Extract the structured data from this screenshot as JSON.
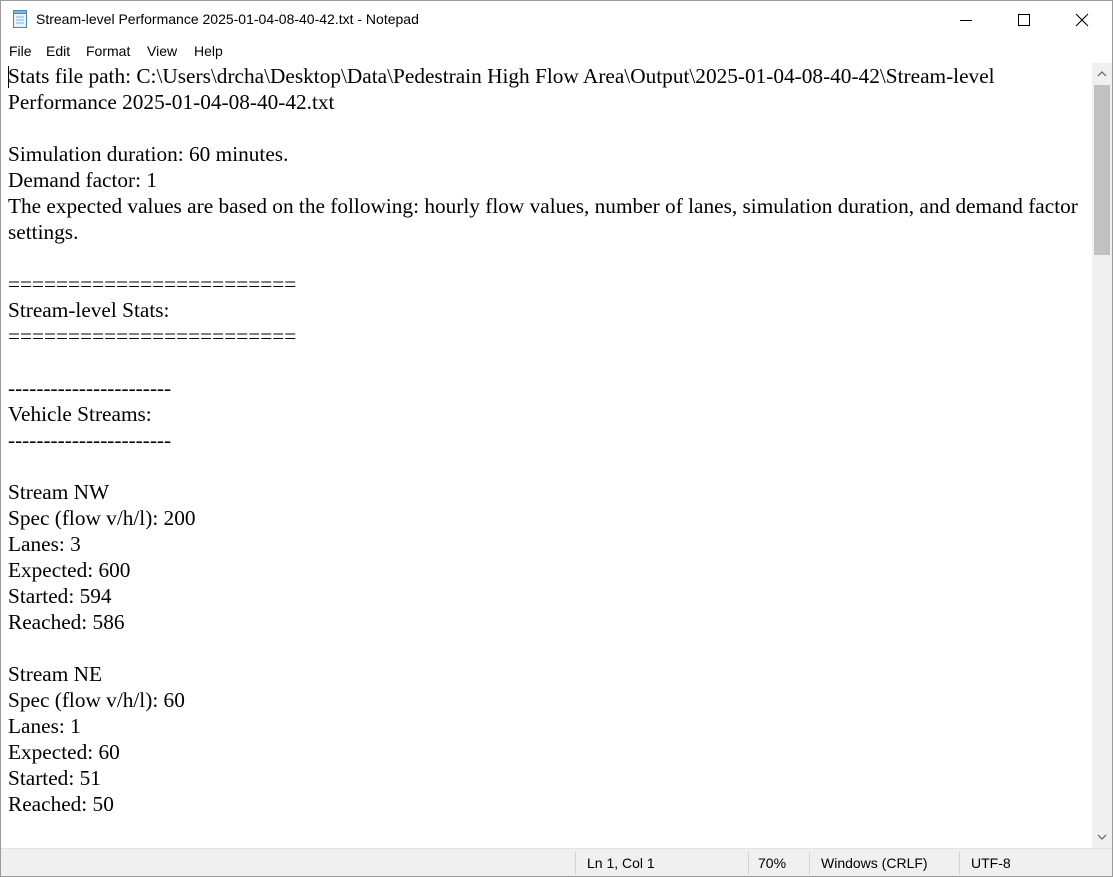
{
  "window": {
    "title": "Stream-level Performance 2025-01-04-08-40-42.txt - Notepad",
    "icon": "notepad-icon",
    "controls": [
      "minimize-icon",
      "maximize-icon",
      "close-icon"
    ]
  },
  "menu": {
    "file": "File",
    "edit": "Edit",
    "format": "Format",
    "view": "View",
    "help": "Help"
  },
  "editor": {
    "content": "Stats file path: C:\\Users\\drcha\\Desktop\\Data\\Pedestrain High Flow Area\\Output\\2025-01-04-08-40-42\\Stream-level Performance 2025-01-04-08-40-42.txt\n\nSimulation duration: 60 minutes.\nDemand factor: 1\nThe expected values are based on the following: hourly flow values, number of lanes, simulation duration, and demand factor settings.\n\n========================\nStream-level Stats:\n========================\n\n-----------------------\nVehicle Streams:\n-----------------------\n\nStream NW\nSpec (flow v/h/l): 200\nLanes: 3\nExpected: 600\nStarted: 594\nReached: 586\n\nStream NE\nSpec (flow v/h/l): 60\nLanes: 1\nExpected: 60\nStarted: 51\nReached: 50"
  },
  "status": {
    "position": "Ln 1, Col 1",
    "zoom": "70%",
    "line_ending": "Windows (CRLF)",
    "encoding": "UTF-8"
  },
  "colors": {
    "status_bar_bg": "#f0f0f0",
    "scroll_thumb": "#c1c1c1"
  }
}
